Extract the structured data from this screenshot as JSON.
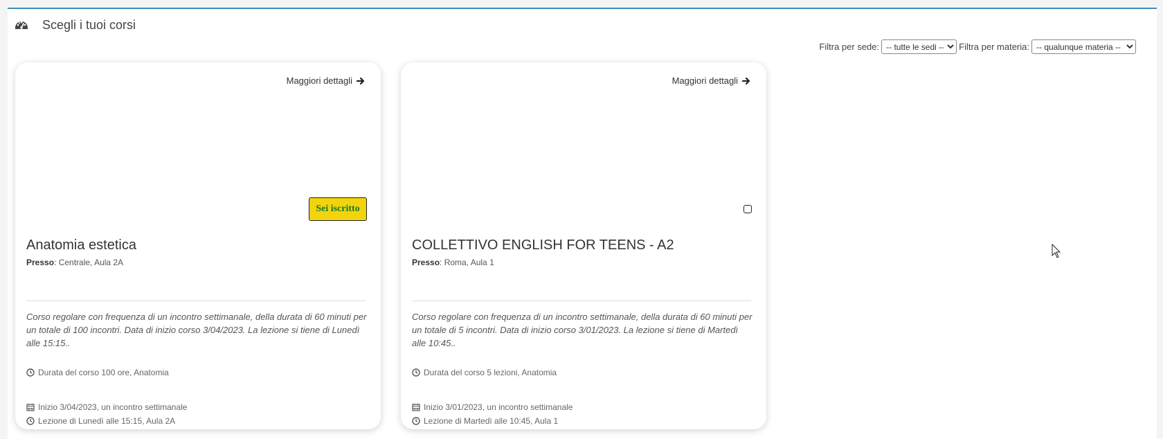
{
  "header": {
    "icon": "dashboard-icon",
    "title": "Scegli i tuoi corsi"
  },
  "filters": {
    "sede_label": "Filtra per sede:",
    "sede_selected": "-- tutte le sedi --",
    "materia_label": "Filtra per materia:",
    "materia_selected": "-- qualunque materia --"
  },
  "courses": [
    {
      "details_label": "Maggiori dettagli",
      "enrolled_label": "Sei iscritto",
      "title": "Anatomia estetica",
      "location_label": "Presso",
      "location": ": Centrale, Aula 2A",
      "description": "Corso regolare con frequenza di un incontro settimanale, della durata di 60 minuti per un totale di 100 incontri. Data di inizio corso 3/04/2023. La lezione si tiene di Lunedì alle 15:15..",
      "duration": "Durata del corso 100 ore, Anatomia",
      "start": "Inizio 3/04/2023, un incontro settimanale",
      "lesson": "Lezione di Lunedì alle 15:15, Aula 2A"
    },
    {
      "details_label": "Maggiori dettagli",
      "title": "COLLETTIVO ENGLISH FOR TEENS - A2",
      "location_label": "Presso",
      "location": ": Roma, Aula 1",
      "description": "Corso regolare con frequenza di un incontro settimanale, della durata di 60 minuti per un totale di 5 incontri. Data di inizio corso 3/01/2023. La lezione si tiene di Martedì alle 10:45..",
      "duration": "Durata del corso 5 lezioni, Anatomia",
      "start": "Inizio 3/01/2023, un incontro settimanale",
      "lesson": "Lezione di Martedì alle 10:45, Aula 1"
    }
  ],
  "colors": {
    "accent": "#3c8dbc",
    "badge_bg": "#f2d40e",
    "badge_text": "#1d7a1d"
  }
}
